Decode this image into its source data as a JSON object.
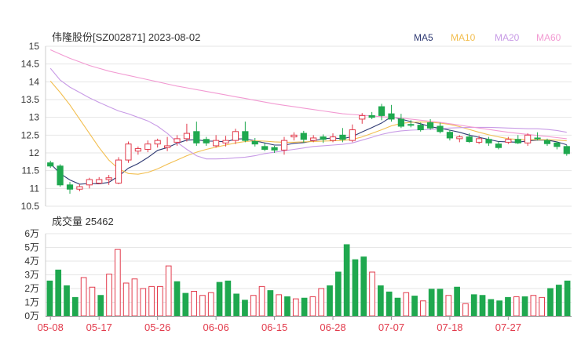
{
  "header": {
    "title": "伟隆股份[SZ002871] 2023-08-02"
  },
  "legend": [
    {
      "key": "ma5",
      "label": "MA5",
      "color": "#2f3a73"
    },
    {
      "key": "ma10",
      "label": "MA10",
      "color": "#f2be4f"
    },
    {
      "key": "ma20",
      "label": "MA20",
      "color": "#c89be6"
    },
    {
      "key": "ma60",
      "label": "MA60",
      "color": "#f29ad2"
    }
  ],
  "colors": {
    "up": "#e23b4c",
    "down": "#1fa84f",
    "grid": "#e6e6e6",
    "axis_text": "#333333",
    "date_text": "#e23b4c"
  },
  "volume": {
    "label": "成交量 25462"
  },
  "chart_data": [
    {
      "type": "candlestick",
      "ylim": [
        10.5,
        15
      ],
      "y_ticks": [
        "10.5",
        "11",
        "11.5",
        "12",
        "12.5",
        "13",
        "13.5",
        "14",
        "14.5",
        "15"
      ],
      "x_labels": [
        "05-08",
        "05-17",
        "05-26",
        "06-06",
        "06-15",
        "06-28",
        "07-07",
        "07-18",
        "07-27"
      ],
      "x_label_index": [
        0,
        5,
        11,
        17,
        23,
        29,
        35,
        41,
        47
      ],
      "candles": [
        [
          11.72,
          11.63,
          11.78,
          11.58
        ],
        [
          11.63,
          11.1,
          11.68,
          11.05
        ],
        [
          11.1,
          10.98,
          11.18,
          10.85
        ],
        [
          10.98,
          11.05,
          11.12,
          10.92
        ],
        [
          11.1,
          11.25,
          11.3,
          11.0
        ],
        [
          11.15,
          11.25,
          11.32,
          11.12
        ],
        [
          11.25,
          11.3,
          11.38,
          11.1
        ],
        [
          11.15,
          11.8,
          11.88,
          11.12
        ],
        [
          11.8,
          12.25,
          12.32,
          11.72
        ],
        [
          12.05,
          12.12,
          12.18,
          11.95
        ],
        [
          12.1,
          12.25,
          12.35,
          12.02
        ],
        [
          12.25,
          12.35,
          12.4,
          12.15
        ],
        [
          12.15,
          12.2,
          12.45,
          12.05
        ],
        [
          12.3,
          12.4,
          12.5,
          12.2
        ],
        [
          12.4,
          12.55,
          12.82,
          12.32
        ],
        [
          12.6,
          12.28,
          12.88,
          12.2
        ],
        [
          12.38,
          12.28,
          12.45,
          12.2
        ],
        [
          12.2,
          12.35,
          12.5,
          12.15
        ],
        [
          12.28,
          12.35,
          12.48,
          12.18
        ],
        [
          12.35,
          12.6,
          12.68,
          12.25
        ],
        [
          12.6,
          12.35,
          12.88,
          12.3
        ],
        [
          12.32,
          12.25,
          12.42,
          12.18
        ],
        [
          12.18,
          12.1,
          12.28,
          12.05
        ],
        [
          12.15,
          12.08,
          12.2,
          12.0
        ],
        [
          12.08,
          12.35,
          12.45,
          11.95
        ],
        [
          12.45,
          12.5,
          12.58,
          12.35
        ],
        [
          12.55,
          12.38,
          12.62,
          12.28
        ],
        [
          12.35,
          12.42,
          12.5,
          12.3
        ],
        [
          12.45,
          12.38,
          12.52,
          12.28
        ],
        [
          12.35,
          12.45,
          12.55,
          12.3
        ],
        [
          12.5,
          12.38,
          12.7,
          12.3
        ],
        [
          12.35,
          12.65,
          12.8,
          12.3
        ],
        [
          12.95,
          13.05,
          13.12,
          12.82
        ],
        [
          13.05,
          13.0,
          13.15,
          12.95
        ],
        [
          13.3,
          13.05,
          13.38,
          12.92
        ],
        [
          13.1,
          12.95,
          13.35,
          12.88
        ],
        [
          12.95,
          12.75,
          13.1,
          12.7
        ],
        [
          12.8,
          12.78,
          12.92,
          12.72
        ],
        [
          12.78,
          12.65,
          12.85,
          12.6
        ],
        [
          12.85,
          12.7,
          12.95,
          12.65
        ],
        [
          12.75,
          12.6,
          12.85,
          12.55
        ],
        [
          12.58,
          12.42,
          12.65,
          12.35
        ],
        [
          12.4,
          12.45,
          12.5,
          12.3
        ],
        [
          12.45,
          12.32,
          12.55,
          12.28
        ],
        [
          12.3,
          12.4,
          12.48,
          12.25
        ],
        [
          12.38,
          12.28,
          12.45,
          12.2
        ],
        [
          12.25,
          12.15,
          12.32,
          12.1
        ],
        [
          12.3,
          12.38,
          12.45,
          12.25
        ],
        [
          12.38,
          12.28,
          12.5,
          12.25
        ],
        [
          12.28,
          12.5,
          12.55,
          12.2
        ],
        [
          12.42,
          12.4,
          12.58,
          12.35
        ],
        [
          12.35,
          12.26,
          12.4,
          12.2
        ],
        [
          12.28,
          12.18,
          12.32,
          12.1
        ],
        [
          12.18,
          11.98,
          12.22,
          11.92
        ]
      ],
      "ma5": [
        11.7,
        11.42,
        11.24,
        11.12,
        11.14,
        11.13,
        11.17,
        11.35,
        11.57,
        11.7,
        11.87,
        12.07,
        12.15,
        12.27,
        12.36,
        12.37,
        12.33,
        12.33,
        12.31,
        12.39,
        12.4,
        12.34,
        12.28,
        12.22,
        12.22,
        12.27,
        12.29,
        12.34,
        12.4,
        12.42,
        12.4,
        12.46,
        12.59,
        12.71,
        12.84,
        13.02,
        12.95,
        12.88,
        12.82,
        12.74,
        12.69,
        12.64,
        12.58,
        12.5,
        12.44,
        12.38,
        12.32,
        12.31,
        12.3,
        12.34,
        12.36,
        12.36,
        12.31,
        12.23
      ],
      "ma10": [
        14.02,
        13.7,
        13.35,
        12.95,
        12.55,
        12.15,
        11.8,
        11.55,
        11.42,
        11.4,
        11.45,
        11.55,
        11.68,
        11.8,
        11.92,
        12.02,
        12.1,
        12.16,
        12.22,
        12.28,
        12.32,
        12.34,
        12.33,
        12.31,
        12.3,
        12.3,
        12.31,
        12.32,
        12.33,
        12.34,
        12.35,
        12.38,
        12.45,
        12.55,
        12.65,
        12.76,
        12.83,
        12.86,
        12.87,
        12.86,
        12.84,
        12.8,
        12.74,
        12.66,
        12.58,
        12.51,
        12.45,
        12.4,
        12.38,
        12.37,
        12.37,
        12.37,
        12.36,
        12.34
      ],
      "ma20": [
        14.38,
        14.05,
        13.85,
        13.7,
        13.55,
        13.42,
        13.3,
        13.18,
        13.1,
        13.0,
        12.9,
        12.75,
        12.55,
        12.3,
        12.1,
        11.92,
        11.83,
        11.83,
        11.84,
        11.86,
        11.88,
        11.92,
        11.98,
        12.02,
        12.06,
        12.1,
        12.14,
        12.18,
        12.2,
        12.22,
        12.24,
        12.28,
        12.36,
        12.44,
        12.52,
        12.58,
        12.62,
        12.64,
        12.65,
        12.66,
        12.68,
        12.7,
        12.71,
        12.72,
        12.72,
        12.72,
        12.71,
        12.7,
        12.69,
        12.68,
        12.68,
        12.66,
        12.63,
        12.58
      ],
      "ma60": [
        14.9,
        14.78,
        14.66,
        14.56,
        14.46,
        14.38,
        14.3,
        14.24,
        14.18,
        14.12,
        14.06,
        14.0,
        13.94,
        13.88,
        13.83,
        13.78,
        13.73,
        13.68,
        13.63,
        13.58,
        13.53,
        13.48,
        13.43,
        13.38,
        13.34,
        13.3,
        13.26,
        13.22,
        13.18,
        13.14,
        13.1,
        13.08,
        13.06,
        13.04,
        13.02,
        13.0,
        12.98,
        12.95,
        12.92,
        12.89,
        12.86,
        12.82,
        12.78,
        12.74,
        12.7,
        12.66,
        12.62,
        12.58,
        12.55,
        12.52,
        12.49,
        12.46,
        12.43,
        12.4
      ]
    },
    {
      "type": "bar",
      "ylim": [
        0,
        60000
      ],
      "y_ticks": [
        "6万",
        "5万",
        "4万",
        "3万",
        "2万",
        "1万",
        "0万"
      ],
      "values": [
        25500,
        33500,
        22000,
        13500,
        28000,
        21000,
        15000,
        30500,
        48500,
        24000,
        27000,
        20000,
        21500,
        21500,
        36500,
        25000,
        16500,
        18000,
        15000,
        17000,
        24500,
        25500,
        16000,
        11500,
        15000,
        21500,
        18500,
        15500,
        14000,
        12500,
        13000,
        14000,
        20000,
        22000,
        32000,
        52000,
        41000,
        43000,
        32000,
        22000,
        17500,
        13000,
        17000,
        14500,
        11000,
        19500,
        19500,
        15000,
        21000,
        9000,
        15500,
        15000,
        12000,
        11000,
        13500,
        14000,
        14000,
        15000,
        13500,
        20000,
        22500,
        25500
      ],
      "up": [
        false,
        false,
        false,
        false,
        true,
        true,
        false,
        true,
        true,
        true,
        true,
        true,
        true,
        true,
        true,
        false,
        false,
        true,
        true,
        true,
        false,
        false,
        false,
        false,
        true,
        true,
        false,
        true,
        false,
        true,
        false,
        true,
        true,
        false,
        false,
        false,
        false,
        false,
        true,
        false,
        false,
        false,
        true,
        false,
        true,
        false,
        false,
        true,
        false,
        true,
        false,
        false,
        false,
        false,
        false,
        true,
        false,
        true,
        true,
        false,
        false,
        false
      ]
    }
  ]
}
